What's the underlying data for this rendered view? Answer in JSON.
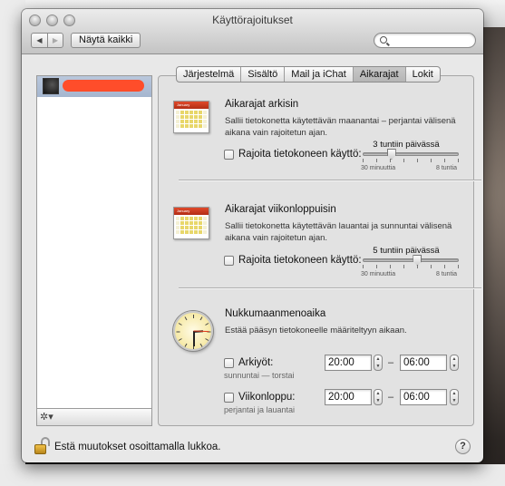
{
  "window": {
    "title": "Käyttörajoitukset",
    "show_all": "Näytä kaikki",
    "search_placeholder": ""
  },
  "tabs": [
    "Järjestelmä",
    "Sisältö",
    "Mail ja iChat",
    "Aikarajat",
    "Lokit"
  ],
  "active_tab": "Aikarajat",
  "weekdays": {
    "title": "Aikarajat arkisin",
    "desc_1": "Sallii tietokonetta käytettävän maanantai – perjantai välisenä",
    "desc_2": "aikana vain rajoitetun ajan.",
    "checkbox_label": "Rajoita tietokoneen käyttö:",
    "slider_value": "3 tuntiin päivässä",
    "slider_min": "30 minuuttia",
    "slider_max": "8 tuntia",
    "slider_fraction": 0.3
  },
  "weekend": {
    "title": "Aikarajat viikonloppuisin",
    "desc_1": "Sallii tietokonetta käytettävän lauantai ja sunnuntai välisenä",
    "desc_2": "aikana vain rajoitetun ajan.",
    "checkbox_label": "Rajoita tietokoneen käyttö:",
    "slider_value": "5 tuntiin päivässä",
    "slider_min": "30 minuuttia",
    "slider_max": "8 tuntia",
    "slider_fraction": 0.57
  },
  "bedtime": {
    "title": "Nukkumaanmenoaika",
    "desc": "Estää pääsyn tietokoneelle määriteltyyn aikaan.",
    "school_nights": {
      "label": "Arkiyöt:",
      "sub": "sunnuntai — torstai",
      "from": "20:00",
      "to": "06:00"
    },
    "weekend": {
      "label": "Viikonloppu:",
      "sub": "perjantai ja lauantai",
      "from": "20:00",
      "to": "06:00"
    },
    "dash": "–"
  },
  "footer": {
    "lock_text": "Estä muutokset osoittamalla lukkoa.",
    "help": "?"
  },
  "list_footer": {
    "gear": "✲▾"
  },
  "colors": {
    "redaction": "#ff4d2a",
    "selection": "#a5b6cf"
  }
}
